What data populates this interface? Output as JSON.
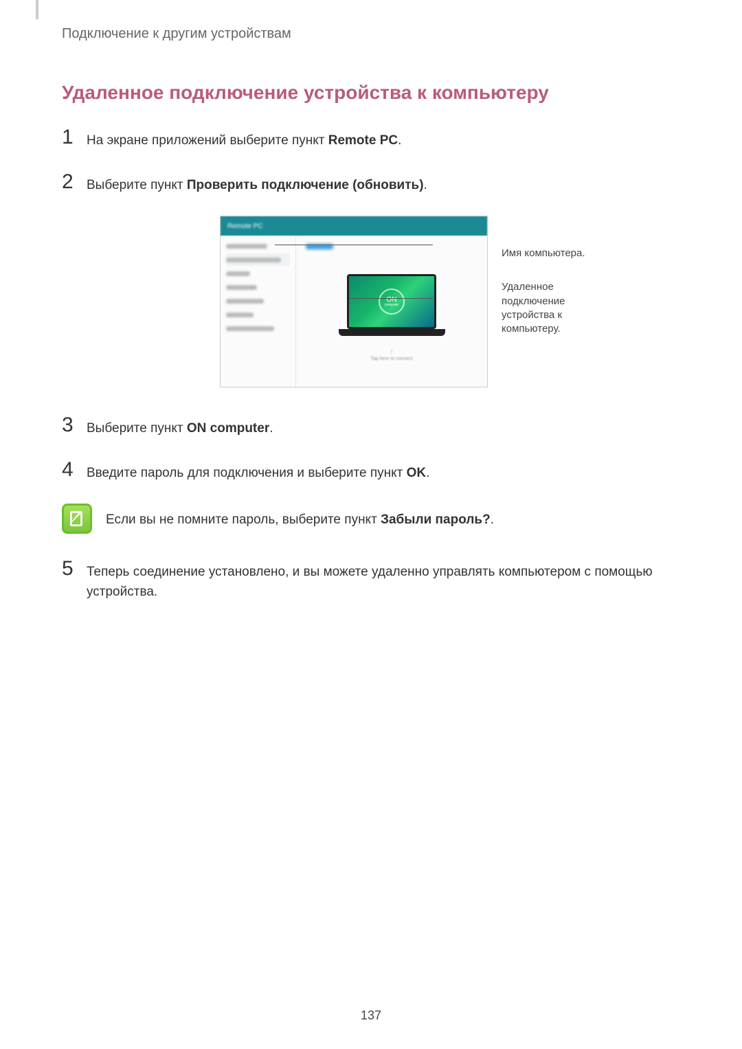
{
  "breadcrumb": "Подключение к другим устройствам",
  "section_title": "Удаленное подключение устройства к компьютеру",
  "steps": {
    "s1": {
      "num": "1",
      "pre": "На экране приложений выберите пункт ",
      "bold": "Remote PC",
      "post": "."
    },
    "s2": {
      "num": "2",
      "pre": "Выберите пункт ",
      "bold": "Проверить подключение (обновить)",
      "post": "."
    },
    "s3": {
      "num": "3",
      "pre": "Выберите пункт ",
      "bold": "ON computer",
      "post": "."
    },
    "s4": {
      "num": "4",
      "pre": "Введите пароль для подключения и выберите пункт ",
      "bold": "OK",
      "post": "."
    },
    "s5": {
      "num": "5",
      "text": "Теперь соединение установлено, и вы можете удаленно управлять компьютером с помощью устройства."
    }
  },
  "note": {
    "pre": "Если вы не помните пароль, выберите пункт ",
    "bold": "Забыли пароль?",
    "post": "."
  },
  "callouts": {
    "c1": "Имя компьютера.",
    "c2": "Удаленное подключение устройства к компьютеру."
  },
  "figure": {
    "header_label": "Remote PC",
    "on_label": "ON",
    "on_sub": "computer"
  },
  "page_number": "137"
}
